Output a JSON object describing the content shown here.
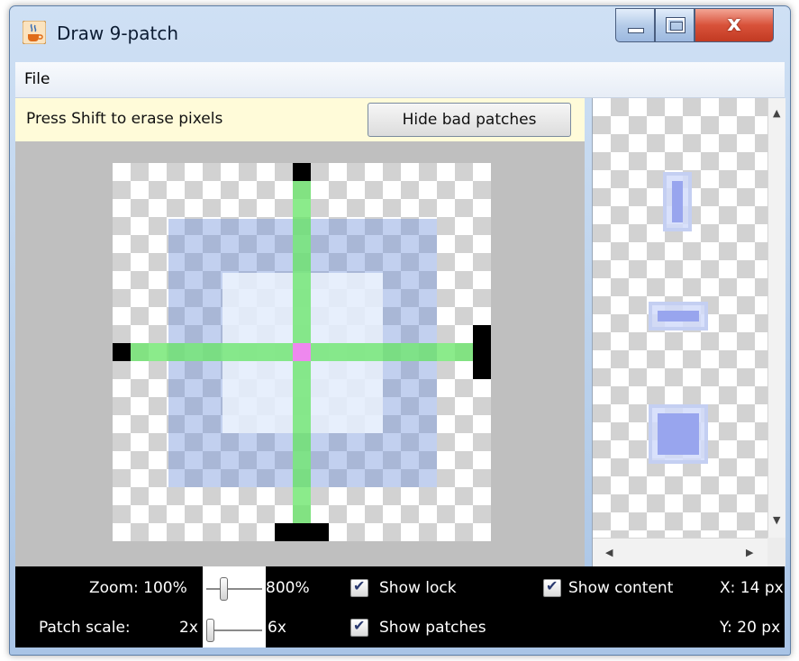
{
  "window": {
    "title": "Draw 9-patch",
    "controls": {
      "close_glyph": "x"
    }
  },
  "menu": {
    "file": "File"
  },
  "editor": {
    "hint": "Press Shift to erase pixels",
    "hide_bad_patches": "Hide bad patches"
  },
  "status": {
    "zoom_label": "Zoom: 100%",
    "zoom_max": "800%",
    "zoom_level": 1,
    "patch_scale_label": "Patch scale:",
    "patch_min": "2x",
    "patch_max": "6x",
    "patch_scale_value": 2,
    "show_lock": "Show lock",
    "show_patches": "Show patches",
    "show_content": "Show content",
    "x_readout": "X: 14 px",
    "y_readout": "Y: 20 px",
    "show_lock_checked": true,
    "show_patches_checked": true,
    "show_content_checked": true
  },
  "icons": {
    "app": "java-cup-icon",
    "minimize": "minimize-icon",
    "maximize": "maximize-icon",
    "close": "close-icon",
    "scroll_up": "scroll-up-icon",
    "scroll_down": "scroll-down-icon",
    "scroll_left": "scroll-left-icon",
    "scroll_right": "scroll-right-icon"
  },
  "colors": {
    "status_background": "#000000",
    "hint_background": "#fffbd9",
    "guide_green": "#6ee66e",
    "stretch_blue": "#7896dc",
    "patch_marker": "#000000"
  }
}
